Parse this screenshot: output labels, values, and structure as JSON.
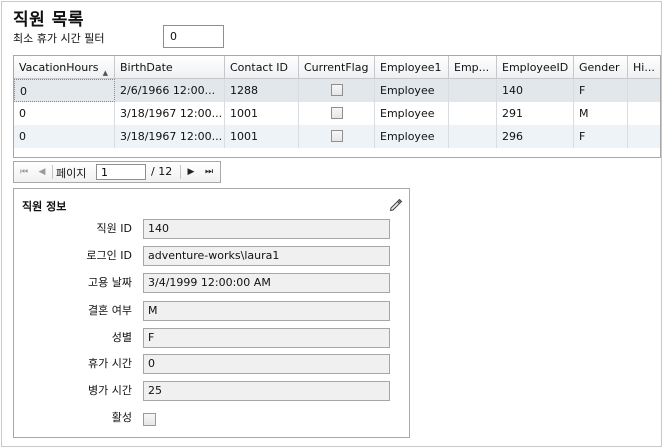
{
  "page": {
    "title": "직원 목록",
    "filter_label": "최소 휴가 시간 필터",
    "filter_value": "0"
  },
  "grid": {
    "columns": [
      "VacationHours",
      "BirthDate",
      "Contact ID",
      "CurrentFlag",
      "Employee1",
      "Emp...",
      "EmployeeID",
      "Gender",
      "Hi..."
    ],
    "sort_column": "VacationHours",
    "sort_direction": "ascending",
    "rows": [
      {
        "VacationHours": "0",
        "BirthDate": "2/6/1966 12:00...",
        "ContactID": "1288",
        "CurrentFlag": false,
        "Employee1": "Employee",
        "Emp": "",
        "EmployeeID": "140",
        "Gender": "F",
        "Hi": ""
      },
      {
        "VacationHours": "0",
        "BirthDate": "3/18/1967 12:00...",
        "ContactID": "1001",
        "CurrentFlag": false,
        "Employee1": "Employee",
        "Emp": "",
        "EmployeeID": "291",
        "Gender": "M",
        "Hi": ""
      },
      {
        "VacationHours": "0",
        "BirthDate": "3/18/1967 12:00...",
        "ContactID": "1001",
        "CurrentFlag": false,
        "Employee1": "Employee",
        "Emp": "",
        "EmployeeID": "296",
        "Gender": "F",
        "Hi": ""
      }
    ]
  },
  "pager": {
    "page_label": "페이지",
    "current_page": "1",
    "total_label": "/ 12"
  },
  "detail": {
    "title": "직원 정보",
    "fields": [
      {
        "label": "직원 ID",
        "value": "140"
      },
      {
        "label": "로그인 ID",
        "value": "adventure-works\\laura1"
      },
      {
        "label": "고용 날짜",
        "value": "3/4/1999 12:00:00 AM"
      },
      {
        "label": "결혼 여부",
        "value": "M"
      },
      {
        "label": "성별",
        "value": "F"
      },
      {
        "label": "휴가 시간",
        "value": "0"
      },
      {
        "label": "병가 시간",
        "value": "25"
      }
    ],
    "active_label": "활성",
    "active_checked": false
  },
  "icons": {
    "edit": "pencil-icon",
    "first": "first-page-icon",
    "prev": "prev-page-icon",
    "next": "next-page-icon",
    "last": "last-page-icon",
    "sort": "sort-ascending-icon"
  }
}
